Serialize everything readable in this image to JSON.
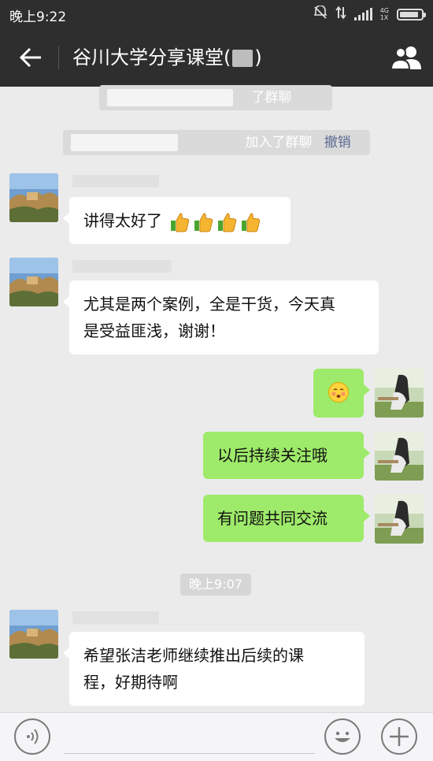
{
  "status_bar": {
    "time": "晚上9:22",
    "network": [
      "4G",
      "1X"
    ],
    "battery_level": 0.9
  },
  "header": {
    "title": "谷川大学分享课堂(",
    "title_suffix": ")"
  },
  "notices": [
    {
      "text": "了群聊"
    },
    {
      "text": "加入了群聊",
      "action": "撤销"
    }
  ],
  "messages": [
    {
      "side": "left",
      "text": "讲得太好了"
    },
    {
      "side": "left",
      "line1": "尤其是两个案例，全是干货，今天真",
      "line2": "是受益匪浅，谢谢！"
    },
    {
      "side": "right",
      "emoji": "blush-emoji"
    },
    {
      "side": "right",
      "text": "以后持续关注哦"
    },
    {
      "side": "right",
      "text": "有问题共同交流"
    },
    {
      "side": "left",
      "line1": "希望张洁老师继续推出后续的课",
      "line2": "程，好期待啊"
    }
  ],
  "timestamp": "晚上9:07",
  "colors": {
    "topbar": "#2e2e2e",
    "background": "#ebebeb",
    "sent_bubble": "#9eea6a",
    "received_bubble": "#ffffff",
    "link": "#5b6a92"
  }
}
